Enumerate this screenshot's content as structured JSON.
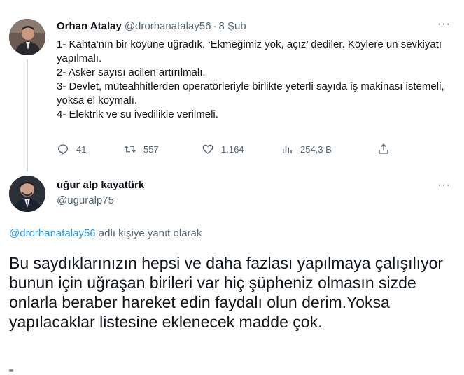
{
  "tweet1": {
    "author_name": "Orhan Atalay",
    "handle": "@drorhanatalay56",
    "separator": "·",
    "date": "8 Şub",
    "lines": [
      "1- Kahta'nın bir köyüne uğradık. ‘Ekmeğimiz yok, açız’ dediler. Köylere un sevkiyatı yapılmalı.",
      "2- Asker sayısı acilen artırılmalı.",
      "3- Devlet, müteahhitlerden operatörleriyle birlikte yeterli sayıda iş makinası istemeli, yoksa el koymalı.",
      "4- Elektrik ve su ivedilikle verilmeli."
    ],
    "reply_count": "41",
    "retweet_count": "557",
    "like_count": "1.164",
    "view_count": "254,3 B",
    "more": "···"
  },
  "tweet2": {
    "author_name": "uğur alp kayatürk",
    "handle": "@uguralp75",
    "more": "···",
    "reply_mention": "@drorhanatalay56",
    "reply_suffix": " adlı kişiye yanıt olarak",
    "text": "Bu saydıklarınızın hepsi ve daha fazlası yapılmaya çalışılıyor bunun için uğraşan birileri var hiç şüpheniz olmasın sizde onlarla beraber hareket edin faydalı olun derim.Yoksa yapılacaklar listesine eklenecek madde çok."
  },
  "colors": {
    "text": "#0f1419",
    "secondary": "#536471",
    "link": "#1d9bf0",
    "thread_line": "#cfd9de"
  },
  "icons": [
    "reply-icon",
    "retweet-icon",
    "like-icon",
    "views-icon",
    "share-icon",
    "more-icon"
  ]
}
